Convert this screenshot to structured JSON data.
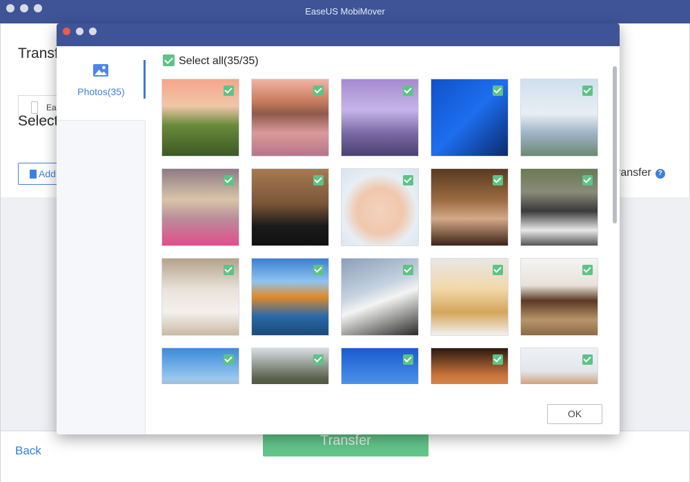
{
  "app": {
    "title": "EaseUS MobiMover"
  },
  "background": {
    "heading_transfer": "Transf",
    "device_label": "Ea",
    "heading_select": "Select",
    "add_label": "Add",
    "transfer_option_label": "ransfer",
    "transfer_button": "Transfer",
    "back_link": "Back"
  },
  "modal": {
    "sidebar": {
      "photos_label": "Photos(35)"
    },
    "select_all_label": "Select all(35/35)",
    "ok_button": "OK",
    "photos": [
      {
        "subject": "sunset-lake-landscape",
        "checked": true
      },
      {
        "subject": "mountain-lake-reflection",
        "checked": true
      },
      {
        "subject": "purple-sky-lake",
        "checked": true
      },
      {
        "subject": "blue-city-skyscrapers",
        "checked": true
      },
      {
        "subject": "curved-modern-building",
        "checked": true
      },
      {
        "subject": "woman-blonde-hair",
        "checked": true
      },
      {
        "subject": "man-portrait",
        "checked": true
      },
      {
        "subject": "surprised-baby",
        "checked": true
      },
      {
        "subject": "woman-curly-hair",
        "checked": true
      },
      {
        "subject": "village-rooftops",
        "checked": true
      },
      {
        "subject": "white-kitten",
        "checked": true
      },
      {
        "subject": "orange-mountain-lake",
        "checked": true
      },
      {
        "subject": "white-curved-architecture",
        "checked": true
      },
      {
        "subject": "golden-puppy",
        "checked": true
      },
      {
        "subject": "puppies-in-basket",
        "checked": true
      },
      {
        "subject": "hillside-town",
        "checked": true
      },
      {
        "subject": "mountain-river",
        "checked": true
      },
      {
        "subject": "blue-bridge",
        "checked": true
      },
      {
        "subject": "orange-cat-closeup",
        "checked": true
      },
      {
        "subject": "dog-closeup",
        "checked": true
      }
    ]
  },
  "colors": {
    "titlebar": "#3e5497",
    "accent": "#3f7fe0",
    "check": "#5dc386",
    "transfer": "#63c68a"
  }
}
